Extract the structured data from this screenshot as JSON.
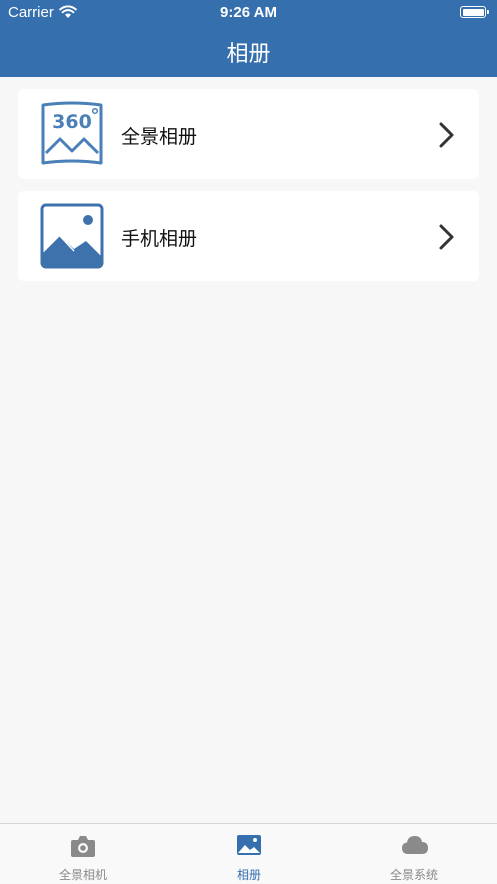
{
  "status_bar": {
    "carrier": "Carrier",
    "time": "9:26 AM"
  },
  "header": {
    "title": "相册"
  },
  "albums": [
    {
      "label": "全景相册",
      "icon": "panorama-360-icon"
    },
    {
      "label": "手机相册",
      "icon": "photo-icon"
    }
  ],
  "tabbar": {
    "items": [
      {
        "label": "全景相机",
        "icon": "camera-icon",
        "active": false
      },
      {
        "label": "相册",
        "icon": "photo-icon",
        "active": true
      },
      {
        "label": "全景系统",
        "icon": "cloud-icon",
        "active": false
      }
    ]
  },
  "colors": {
    "brand": "#356fad",
    "inactive": "#8a8a8a",
    "background": "#f7f7f7"
  }
}
